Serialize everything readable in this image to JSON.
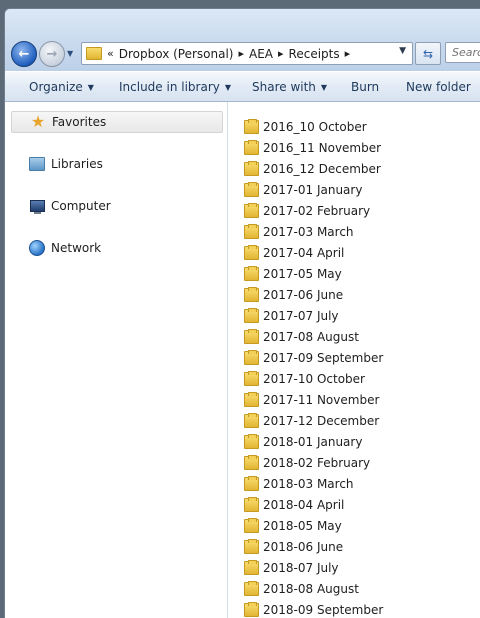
{
  "address_bar": {
    "crumbs": [
      "Dropbox (Personal)",
      "AEA",
      "Receipts"
    ],
    "overflow_label": "«",
    "separator": "▸"
  },
  "search": {
    "placeholder": "Search"
  },
  "commands": [
    {
      "label": "Organize",
      "has_menu": true
    },
    {
      "label": "Include in library",
      "has_menu": true
    },
    {
      "label": "Share with",
      "has_menu": true
    },
    {
      "label": "Burn",
      "has_menu": false
    },
    {
      "label": "New folder",
      "has_menu": false
    }
  ],
  "navigation": [
    {
      "label": "Favorites",
      "icon": "star-icon",
      "selected": true
    },
    {
      "label": "Libraries",
      "icon": "libraries-icon",
      "selected": false
    },
    {
      "label": "Computer",
      "icon": "computer-icon",
      "selected": false
    },
    {
      "label": "Network",
      "icon": "network-icon",
      "selected": false
    }
  ],
  "folders": [
    "2016_10 October",
    "2016_11 November",
    "2016_12 December",
    "2017-01 January",
    "2017-02 February",
    "2017-03 March",
    "2017-04 April",
    "2017-05 May",
    "2017-06 June",
    "2017-07 July",
    "2017-08 August",
    "2017-09 September",
    "2017-10 October",
    "2017-11 November",
    "2017-12 December",
    "2018-01 January",
    "2018-02 February",
    "2018-03 March",
    "2018-04 April",
    "2018-05 May",
    "2018-06 June",
    "2018-07 July",
    "2018-08 August",
    "2018-09 September"
  ],
  "colors": {
    "folder": "#e2b533",
    "command_text": "#1e395b",
    "navbar_bg": "#c9daee",
    "back_button": "#1f5fbf"
  }
}
